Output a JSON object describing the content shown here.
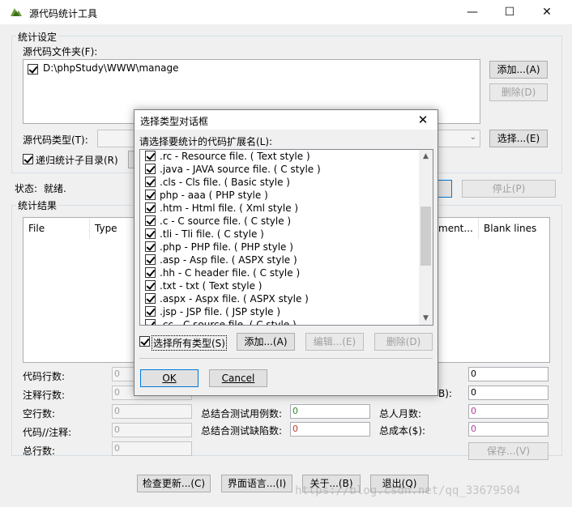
{
  "window": {
    "title": "源代码统计工具",
    "min_glyph": "—",
    "max_glyph": "☐",
    "close_glyph": "✕"
  },
  "settings": {
    "group_label": "统计设定",
    "folder_label": "源代码文件夹(F):",
    "folders": [
      "D:\\phpStudy\\WWW\\manage"
    ],
    "add_button": "添加...(A)",
    "delete_button": "删除(D)",
    "type_label": "源代码类型(T):",
    "select_button": "选择...(E)",
    "recursive_label": "递归统计子目录(R)"
  },
  "status": {
    "label": "状态:",
    "value": "就绪.",
    "stop_button": "停止(P)"
  },
  "results": {
    "group_label": "统计结果",
    "columns": [
      "File",
      "Type",
      "ment...",
      "Blank lines"
    ]
  },
  "stats": {
    "left": [
      {
        "label": "代码行数:",
        "value": "0"
      },
      {
        "label": "注释行数:",
        "value": "0"
      },
      {
        "label": "空行数:",
        "value": "0"
      },
      {
        "label": "代码//注释:",
        "value": "0"
      },
      {
        "label": "总行数:",
        "value": "0"
      }
    ],
    "middle": [
      {
        "label": "总结合测试用例数:",
        "value": "0"
      },
      {
        "label": "总结合测试缺陷数:",
        "value": "0"
      }
    ],
    "right": [
      {
        "label": "",
        "value": "0"
      },
      {
        "label": "B):",
        "value": "0"
      },
      {
        "label": "总人月数:",
        "value": "0"
      },
      {
        "label": "总成本($):",
        "value": "0"
      }
    ],
    "save_button": "保存...(V)"
  },
  "bottom_buttons": [
    "检查更新...(C)",
    "界面语言...(I)",
    "关于...(B)",
    "退出(Q)"
  ],
  "watermark": "https://blog.csdn.net/qq_33679504",
  "dialog": {
    "title": "选择类型对话框",
    "close_glyph": "✕",
    "prompt": "请选择要统计的代码扩展名(L):",
    "extensions": [
      ".rc - Resource file. ( Text style )",
      ".java - JAVA source file. ( C style )",
      ".cls - Cls file. ( Basic style )",
      "php - aaa ( PHP style )",
      ".htm - Html file. ( Xml style )",
      ".c - C source file. ( C style )",
      ".tli - Tli file. ( C style )",
      ".php - PHP file. ( PHP style )",
      ".asp - Asp file. ( ASPX style )",
      ".hh - C header file. ( C style )",
      ".txt - txt ( Text style )",
      ".aspx - Aspx file. ( ASPX style )",
      ".jsp - JSP file. ( JSP style )",
      ".cc - C source file. ( C style )"
    ],
    "select_all_label": "选择所有类型(S)",
    "add_button": "添加...(A)",
    "edit_button": "编辑...(E)",
    "delete_button": "删除(D)",
    "ok_button": "OK",
    "cancel_button": "Cancel"
  }
}
